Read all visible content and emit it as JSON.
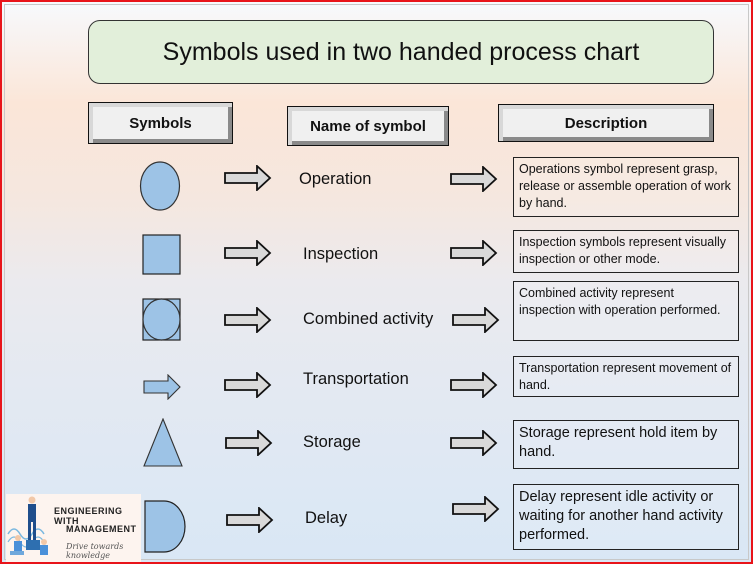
{
  "title": "Symbols used in two handed process chart",
  "headers": {
    "symbols": "Symbols",
    "name": "Name of symbol",
    "description": "Description"
  },
  "colors": {
    "symbol_fill": "#9dc3e6",
    "title_fill": "#e2efda",
    "border_accent": "#e8141a"
  },
  "rows": [
    {
      "symbol": "circle",
      "name": "Operation",
      "description": "Operations symbol represent grasp, release or assemble operation of work by hand."
    },
    {
      "symbol": "square",
      "name": "Inspection",
      "description": "Inspection symbols represent visually inspection or other mode."
    },
    {
      "symbol": "circle-in-square",
      "name": "Combined activity",
      "description": "Combined activity represent inspection with operation performed."
    },
    {
      "symbol": "arrow",
      "name": "Transportation",
      "description": "Transportation represent movement of hand."
    },
    {
      "symbol": "triangle",
      "name": "Storage",
      "description": "Storage represent hold item by hand."
    },
    {
      "symbol": "d-shape",
      "name": "Delay",
      "description": "Delay represent idle activity or waiting for another hand activity performed."
    }
  ],
  "logo": {
    "line1": "ENGINEERING WITH",
    "line2": "MANAGEMENT",
    "tagline": "Drive towards knowledge"
  }
}
